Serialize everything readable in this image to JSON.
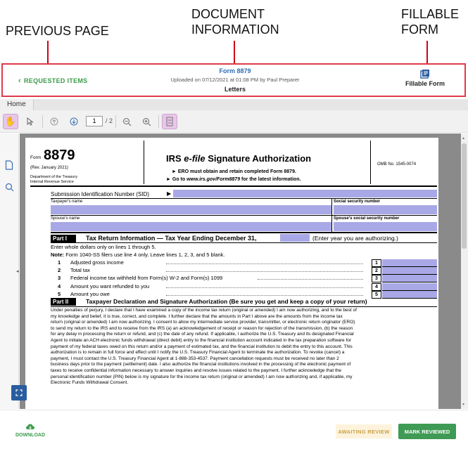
{
  "annotations": {
    "previous_page": "PREVIOUS PAGE",
    "document_information_1": "DOCUMENT",
    "document_information_2": "INFORMATION",
    "fillable_form_1": "FILLABLE",
    "fillable_form_2": "FORM"
  },
  "header": {
    "back_label": "REQUESTED ITEMS",
    "doc_title": "Form 8879",
    "uploaded_text": "Uploaded on 07/12/2021 at 01:08 PM by Paul Preparer",
    "category": "Letters",
    "fillable_label": "Fillable Form"
  },
  "viewer": {
    "tab_home": "Home",
    "page_current": "1",
    "page_total": "/ 2"
  },
  "form": {
    "form_word": "Form",
    "form_number": "8879",
    "rev": "(Rev. January 2021)",
    "dept1": "Department of the Treasury",
    "dept2": "Internal Revenue Service",
    "title_prefix": "IRS ",
    "title_italic": "e-file",
    "title_suffix": " Signature Authorization",
    "sub1": "► ERO must obtain and retain completed Form 8879.",
    "sub2_pre": "► Go to ",
    "sub2_link": "www.irs.gov/Form8879",
    "sub2_post": " for the latest information.",
    "omb": "OMB No. 1545-0074",
    "sid_label": "Submission Identification Number (SID)",
    "taxpayer_name": "Taxpayer's name",
    "ssn": "Social security number",
    "spouse_name": "Spouse's name",
    "spouse_ssn": "Spouse's social security number",
    "part1_tag": "Part I",
    "part1_title": "Tax Return Information — Tax Year Ending December 31,",
    "part1_year_note": "(Enter year you are authorizing.)",
    "whole_dollars": "Enter whole dollars only on lines 1 through 5.",
    "note_bold": "Note:",
    "note_text": " Form 1040-SS filers use line 4 only. Leave lines 1, 2, 3, and 5 blank.",
    "lines": [
      {
        "num": "1",
        "label": "Adjusted gross income"
      },
      {
        "num": "2",
        "label": "Total tax"
      },
      {
        "num": "3",
        "label": "Federal income tax withheld from Form(s) W-2 and Form(s) 1099"
      },
      {
        "num": "4",
        "label": "Amount you want refunded to you"
      },
      {
        "num": "5",
        "label": "Amount you owe"
      }
    ],
    "part2_tag": "Part II",
    "part2_title": "Taxpayer Declaration and Signature Authorization (Be sure you get and keep a copy of your return)",
    "declaration": [
      "Under penalties of perjury, I declare that I have examined a copy of the income tax return (original or amended) I am now authorizing, and to the best of",
      "my knowledge and belief, it is true, correct, and complete. I further declare that the amounts in Part I above are the amounts from the income tax",
      "return (original or amended) I am now authorizing. I consent to allow my intermediate service provider, transmitter, or electronic return originator (ERO)",
      "to send my return to the IRS and to receive from the IRS (a) an acknowledgement of receipt or reason for rejection of the transmission, (b) the reason",
      "for any delay in processing the return or refund, and (c) the date of any refund. If applicable, I authorize the U.S. Treasury and its designated Financial",
      "Agent to initiate an ACH electronic funds withdrawal (direct debit) entry to the financial institution account indicated in the tax preparation software for",
      "payment of my federal taxes owed on this return and/or a payment of estimated tax, and the financial institution to debit the entry to this account. This",
      "authorization is to remain in full force and effect until I notify the U.S. Treasury Financial Agent to terminate the authorization. To revoke (cancel) a",
      "payment, I must contact the U.S. Treasury Financial Agent at 1-888-353-4537. Payment cancellation requests must be received no later than 2",
      "business days prior to the payment (settlement) date. I also authorize the financial institutions involved in the processing of the electronic payment of",
      "taxes to receive confidential information necessary to answer inquiries and resolve issues related to the payment. I further acknowledge that the",
      "personal identification number (PIN) below is my signature for the income tax return (original or amended) I am now authorizing and, if applicable, my",
      "Electronic Funds Withdrawal Consent."
    ]
  },
  "footer": {
    "download_label": "DOWNLOAD",
    "status": "AWAITING REVIEW",
    "mark_reviewed": "MARK REVIEWED"
  },
  "colors": {
    "accent_green": "#3e9a54",
    "link_blue": "#2a6bb5",
    "annotation_red": "#d0021b",
    "field_purple": "#a9a8e6"
  }
}
